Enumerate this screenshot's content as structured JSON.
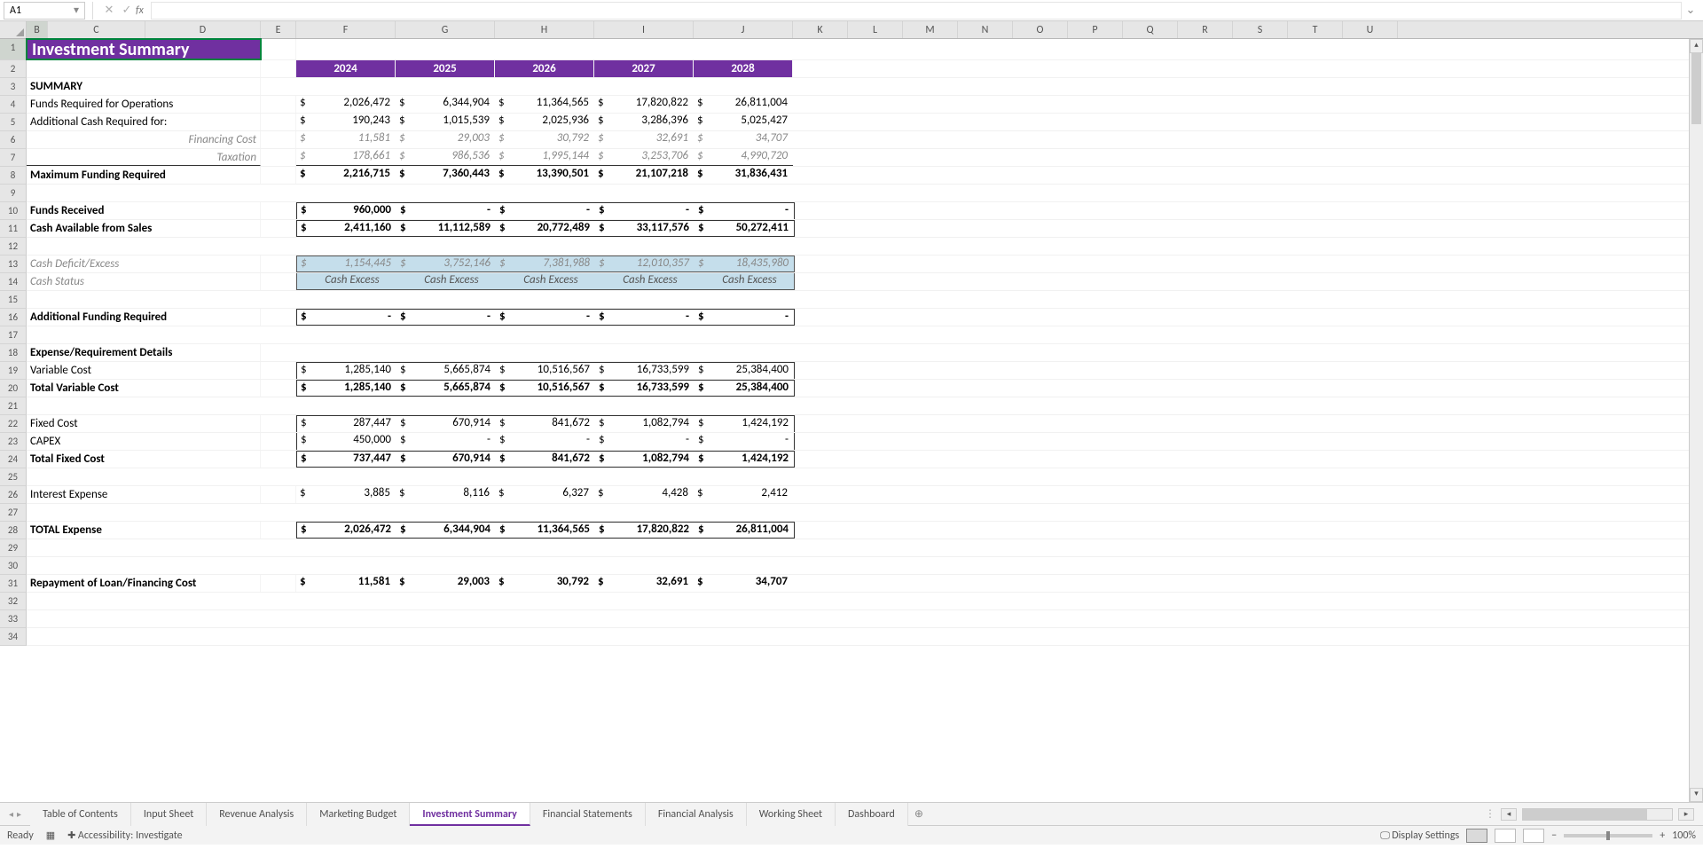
{
  "nameBox": "A1",
  "title": "Investment Summary",
  "years": [
    "2024",
    "2025",
    "2026",
    "2027",
    "2028"
  ],
  "colHeaders": [
    "B",
    "C",
    "D",
    "E",
    "F",
    "G",
    "H",
    "I",
    "J",
    "K",
    "L",
    "M",
    "N",
    "O",
    "P",
    "Q",
    "R",
    "S",
    "T",
    "U"
  ],
  "sections": {
    "summaryHeader": "SUMMARY",
    "fundsRequired": {
      "label": "Funds Required for Operations",
      "vals": [
        "2,026,472",
        "6,344,904",
        "11,364,565",
        "17,820,822",
        "26,811,004"
      ]
    },
    "addlCash": {
      "label": "Additional Cash Required for:",
      "vals": [
        "190,243",
        "1,015,539",
        "2,025,936",
        "3,286,396",
        "5,025,427"
      ]
    },
    "financing": {
      "label": "Financing Cost",
      "vals": [
        "11,581",
        "29,003",
        "30,792",
        "32,691",
        "34,707"
      ]
    },
    "taxation": {
      "label": "Taxation",
      "vals": [
        "178,661",
        "986,536",
        "1,995,144",
        "3,253,706",
        "4,990,720"
      ]
    },
    "maxFunding": {
      "label": "Maximum Funding Required",
      "vals": [
        "2,216,715",
        "7,360,443",
        "13,390,501",
        "21,107,218",
        "31,836,431"
      ]
    },
    "fundsReceived": {
      "label": "Funds Received",
      "vals": [
        "960,000",
        "-",
        "-",
        "-",
        "-"
      ]
    },
    "cashAvailable": {
      "label": "Cash Available from Sales",
      "vals": [
        "2,411,160",
        "11,112,589",
        "20,772,489",
        "33,117,576",
        "50,272,411"
      ]
    },
    "cashDeficit": {
      "label": "Cash Deficit/Excess",
      "vals": [
        "1,154,445",
        "3,752,146",
        "7,381,988",
        "12,010,357",
        "18,435,980"
      ]
    },
    "cashStatus": {
      "label": "Cash Status",
      "vals": [
        "Cash Excess",
        "Cash Excess",
        "Cash Excess",
        "Cash Excess",
        "Cash Excess"
      ]
    },
    "addlFunding": {
      "label": "Additional Funding Required",
      "vals": [
        "-",
        "-",
        "-",
        "-",
        "-"
      ]
    },
    "expHeader": "Expense/Requirement Details",
    "varCost": {
      "label": "Variable Cost",
      "vals": [
        "1,285,140",
        "5,665,874",
        "10,516,567",
        "16,733,599",
        "25,384,400"
      ]
    },
    "totVarCost": {
      "label": "Total Variable Cost",
      "vals": [
        "1,285,140",
        "5,665,874",
        "10,516,567",
        "16,733,599",
        "25,384,400"
      ]
    },
    "fixedCost": {
      "label": "Fixed Cost",
      "vals": [
        "287,447",
        "670,914",
        "841,672",
        "1,082,794",
        "1,424,192"
      ]
    },
    "capex": {
      "label": "CAPEX",
      "vals": [
        "450,000",
        "-",
        "-",
        "-",
        "-"
      ]
    },
    "totFixed": {
      "label": "Total Fixed Cost",
      "vals": [
        "737,447",
        "670,914",
        "841,672",
        "1,082,794",
        "1,424,192"
      ]
    },
    "interest": {
      "label": "Interest Expense",
      "vals": [
        "3,885",
        "8,116",
        "6,327",
        "4,428",
        "2,412"
      ]
    },
    "totalExpense": {
      "label": "TOTAL Expense",
      "vals": [
        "2,026,472",
        "6,344,904",
        "11,364,565",
        "17,820,822",
        "26,811,004"
      ]
    },
    "repayment": {
      "label": "Repayment of Loan/Financing Cost",
      "vals": [
        "11,581",
        "29,003",
        "30,792",
        "32,691",
        "34,707"
      ]
    }
  },
  "sheetTabs": [
    "Table of Contents",
    "Input Sheet",
    "Revenue Analysis",
    "Marketing Budget",
    "Investment Summary",
    "Financial Statements",
    "Financial Analysis",
    "Working Sheet",
    "Dashboard"
  ],
  "activeTab": "Investment Summary",
  "statusBar": {
    "ready": "Ready",
    "accessibility": "Accessibility: Investigate",
    "displaySettings": "Display Settings",
    "zoom": "100%"
  }
}
